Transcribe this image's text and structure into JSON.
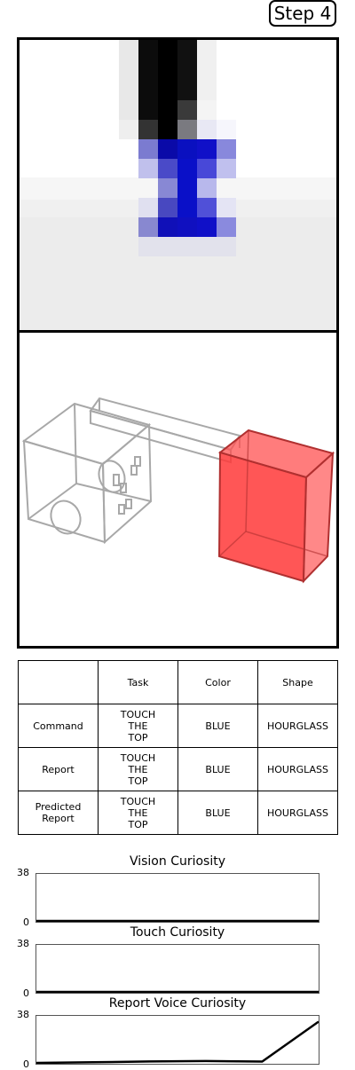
{
  "step_label": "Step 4",
  "table": {
    "headers": [
      "",
      "Task",
      "Color",
      "Shape"
    ],
    "rows": [
      {
        "label": "Command",
        "task": "TOUCH\nTHE\nTOP",
        "color": "BLUE",
        "shape": "HOURGLASS"
      },
      {
        "label": "Report",
        "task": "TOUCH\nTHE\nTOP",
        "color": "BLUE",
        "shape": "HOURGLASS"
      },
      {
        "label": "Predicted\nReport",
        "task": "TOUCH\nTHE\nTOP",
        "color": "BLUE",
        "shape": "HOURGLASS"
      }
    ]
  },
  "chart_data": [
    {
      "type": "line",
      "title": "Vision Curiosity",
      "ylim": [
        0,
        38
      ],
      "yticks": [
        "38",
        "0"
      ],
      "x": [
        0,
        1,
        2,
        3,
        4,
        5
      ],
      "values": [
        0,
        0,
        0,
        0,
        0,
        0
      ],
      "color": "#000000"
    },
    {
      "type": "line",
      "title": "Touch Curiosity",
      "ylim": [
        0,
        38
      ],
      "yticks": [
        "38",
        "0"
      ],
      "x": [
        0,
        1,
        2,
        3,
        4,
        5
      ],
      "values": [
        0,
        0,
        0,
        0,
        0,
        0
      ],
      "color": "#000000"
    },
    {
      "type": "line",
      "title": "Report Voice Curiosity",
      "ylim": [
        0,
        38
      ],
      "yticks": [
        "38",
        "0"
      ],
      "x": [
        0,
        1,
        2,
        3,
        4,
        5
      ],
      "values": [
        0,
        0.5,
        1.2,
        1.5,
        1.1,
        34
      ],
      "color": "#000000"
    }
  ],
  "colors": {
    "target_box": "#ff4040",
    "vision_blue": "#0a10c8"
  }
}
